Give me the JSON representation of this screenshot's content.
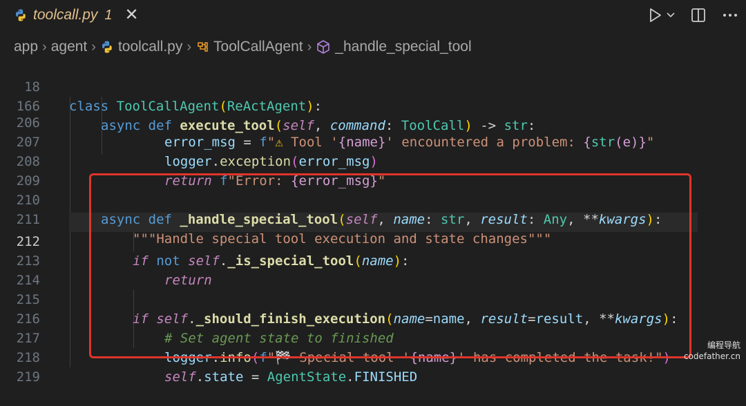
{
  "tab": {
    "filename": "toolcall.py",
    "problems": "1",
    "close": "✕"
  },
  "breadcrumb": {
    "items": [
      "app",
      "agent",
      "toolcall.py",
      "ToolCallAgent",
      "_handle_special_tool"
    ]
  },
  "lines": [
    {
      "n": "18",
      "code": "class ToolCallAgent(ReActAgent):"
    },
    {
      "n": "166",
      "code": "async def execute_tool(self, command: ToolCall) -> str:"
    },
    {
      "n": "206",
      "code": "error_msg = f\"⚠ Tool '{name}' encountered a problem: {str(e)}\""
    },
    {
      "n": "207",
      "code": "logger.exception(error_msg)"
    },
    {
      "n": "208",
      "code": "return f\"Error: {error_msg}\""
    },
    {
      "n": "209",
      "code": ""
    },
    {
      "n": "210",
      "code": "async def _handle_special_tool(self, name: str, result: Any, **kwargs):"
    },
    {
      "n": "211",
      "code": "\"\"\"Handle special tool execution and state changes\"\"\""
    },
    {
      "n": "212",
      "code": "if not self._is_special_tool(name):"
    },
    {
      "n": "213",
      "code": "return"
    },
    {
      "n": "214",
      "code": ""
    },
    {
      "n": "215",
      "code": "if self._should_finish_execution(name=name, result=result, **kwargs):"
    },
    {
      "n": "216",
      "code": "# Set agent state to finished"
    },
    {
      "n": "217",
      "code": "logger.info(f\"🏁 Special tool '{name}' has completed the task!\")"
    },
    {
      "n": "218",
      "code": "self.state = AgentState.FINISHED"
    },
    {
      "n": "219",
      "code": ""
    }
  ],
  "watermark": {
    "line1": "编程导航",
    "line2": "codefather.cn"
  },
  "colors": {
    "highlight": "#e0352b",
    "background": "#1f1f1f"
  }
}
